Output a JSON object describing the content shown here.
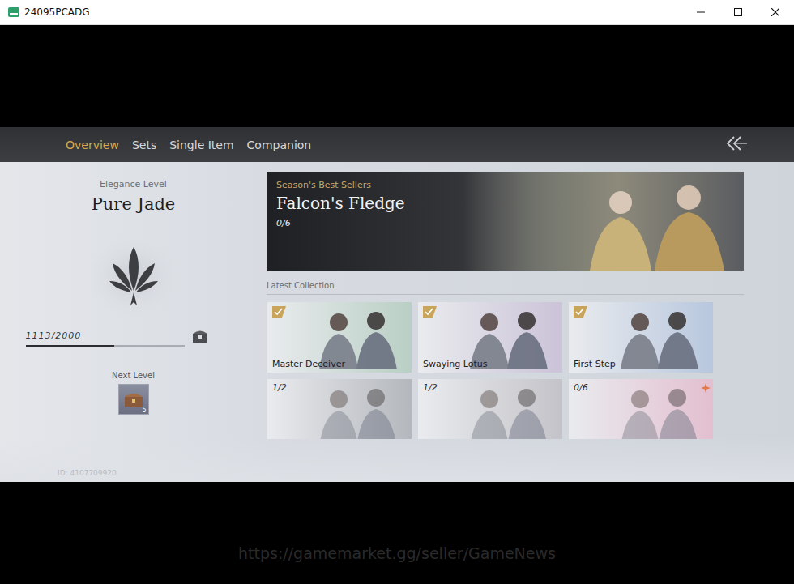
{
  "window": {
    "title": "24095PCADG"
  },
  "tabs": [
    {
      "label": "Overview",
      "selected": true
    },
    {
      "label": "Sets",
      "selected": false
    },
    {
      "label": "Single Item",
      "selected": false
    },
    {
      "label": "Companion",
      "selected": false
    }
  ],
  "elegance": {
    "label": "Elegance Level",
    "rank": "Pure Jade",
    "progress": "1113/2000",
    "level": 0.5565,
    "next_label": "Next Level",
    "next_reward_count": "5",
    "id": "ID: 4107709920"
  },
  "featured": {
    "tag": "Season's Best Sellers",
    "title": "Falcon's Fledge",
    "count": "0/6"
  },
  "collection": {
    "heading": "Latest Collection",
    "items": [
      {
        "kind": "owned",
        "label": "Master Deceiver",
        "color": "#b9cfc4",
        "new": false
      },
      {
        "kind": "owned",
        "label": "Swaying Lotus",
        "color": "#cbc3d8",
        "new": false
      },
      {
        "kind": "owned",
        "label": "First Step",
        "color": "#b8c7de",
        "new": false
      },
      {
        "kind": "progress",
        "count": "1/2",
        "color": "#b4b7bc",
        "new": false
      },
      {
        "kind": "progress",
        "count": "1/2",
        "color": "#c4c3c9",
        "new": false
      },
      {
        "kind": "progress",
        "count": "0/6",
        "color": "#e3bfcf",
        "new": true
      }
    ]
  },
  "watermark": "https://gamemarket.gg/seller/GameNews"
}
